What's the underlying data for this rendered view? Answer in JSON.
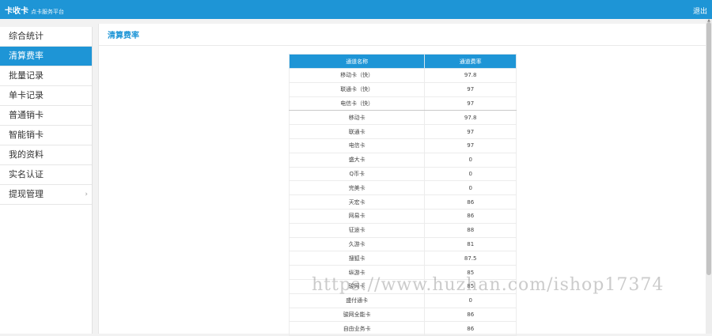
{
  "header": {
    "brand": "卡收卡",
    "brand_sub": "点卡服务平台",
    "logout": "退出"
  },
  "sidebar": {
    "items": [
      {
        "label": "综合统计"
      },
      {
        "label": "清算费率"
      },
      {
        "label": "批量记录"
      },
      {
        "label": "单卡记录"
      },
      {
        "label": "普通销卡"
      },
      {
        "label": "智能销卡"
      },
      {
        "label": "我的资料"
      },
      {
        "label": "实名认证"
      },
      {
        "label": "提现管理",
        "has_submenu": true
      }
    ],
    "active_index": 1
  },
  "main": {
    "title": "清算费率",
    "table": {
      "headers": [
        "通道名称",
        "通道费率"
      ],
      "rows": [
        [
          "移动卡（快）",
          "97.8"
        ],
        [
          "联通卡（快）",
          "97"
        ],
        [
          "电信卡（快）",
          "97"
        ],
        [
          "移动卡",
          "97.8"
        ],
        [
          "联通卡",
          "97"
        ],
        [
          "电信卡",
          "97"
        ],
        [
          "盛大卡",
          "0"
        ],
        [
          "Q币卡",
          "0"
        ],
        [
          "完美卡",
          "0"
        ],
        [
          "天宏卡",
          "86"
        ],
        [
          "网易卡",
          "86"
        ],
        [
          "征途卡",
          "88"
        ],
        [
          "久游卡",
          "81"
        ],
        [
          "搜狐卡",
          "87.5"
        ],
        [
          "纵游卡",
          "85"
        ],
        [
          "骏网卡",
          "85"
        ],
        [
          "盛付通卡",
          "0"
        ],
        [
          "骏网全能卡",
          "86"
        ],
        [
          "自由业务卡",
          "86"
        ]
      ]
    }
  },
  "watermark": "https://www.huzhan.com/ishop17374",
  "colors": {
    "accent": "#1e95d6"
  }
}
